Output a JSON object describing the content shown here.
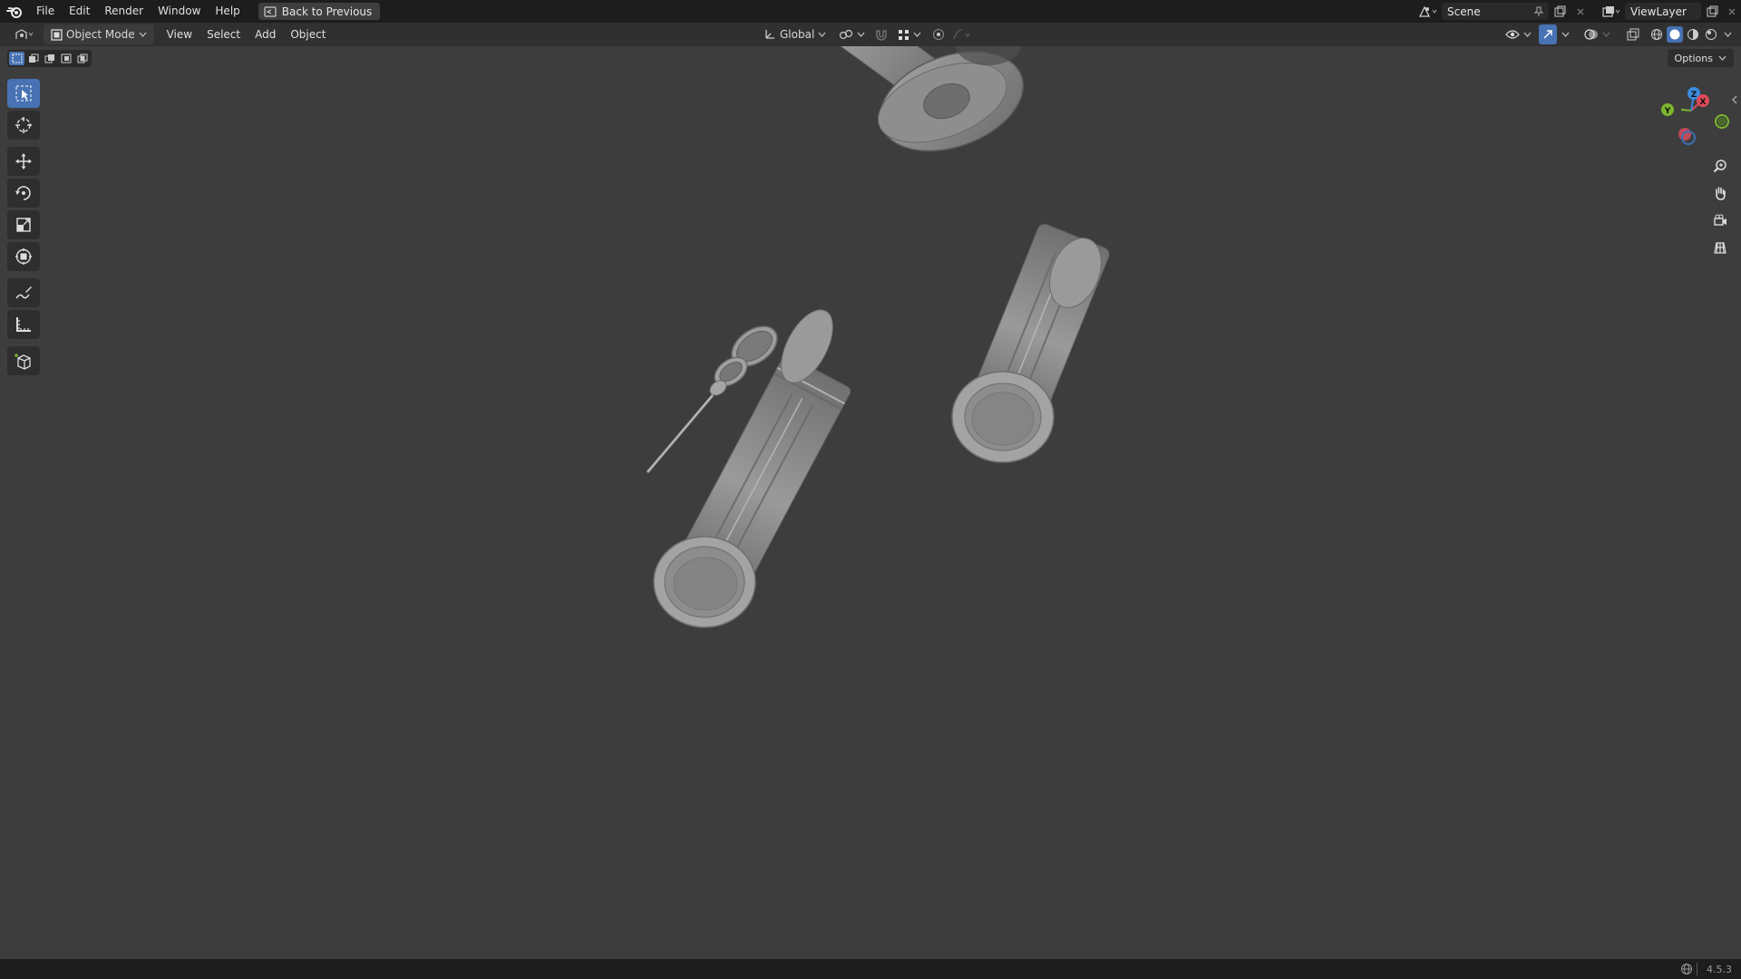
{
  "topbar": {
    "menus": [
      "File",
      "Edit",
      "Render",
      "Window",
      "Help"
    ],
    "back_button": "Back to Previous",
    "scene_name": "Scene",
    "view_layer_name": "ViewLayer"
  },
  "header": {
    "mode": "Object Mode",
    "menus": [
      "View",
      "Select",
      "Add",
      "Object"
    ],
    "transform_orientation": "Global"
  },
  "toolbar": {
    "tools": [
      "select-box",
      "cursor",
      "move",
      "rotate",
      "scale",
      "transform",
      "annotate",
      "measure",
      "add-cube"
    ],
    "active_tool": "select-box"
  },
  "viewport": {
    "options_label": "Options",
    "gizmo_axes": [
      "X",
      "Y",
      "Z"
    ],
    "object_color": "#8a8a8a",
    "background_color": "#3d3d3d"
  },
  "statusbar": {
    "version": "4.5.3"
  },
  "colors": {
    "accent": "#4772b3",
    "axis_x": "#e04a5a",
    "axis_y": "#7bb62e",
    "axis_z": "#3a8ce0"
  }
}
